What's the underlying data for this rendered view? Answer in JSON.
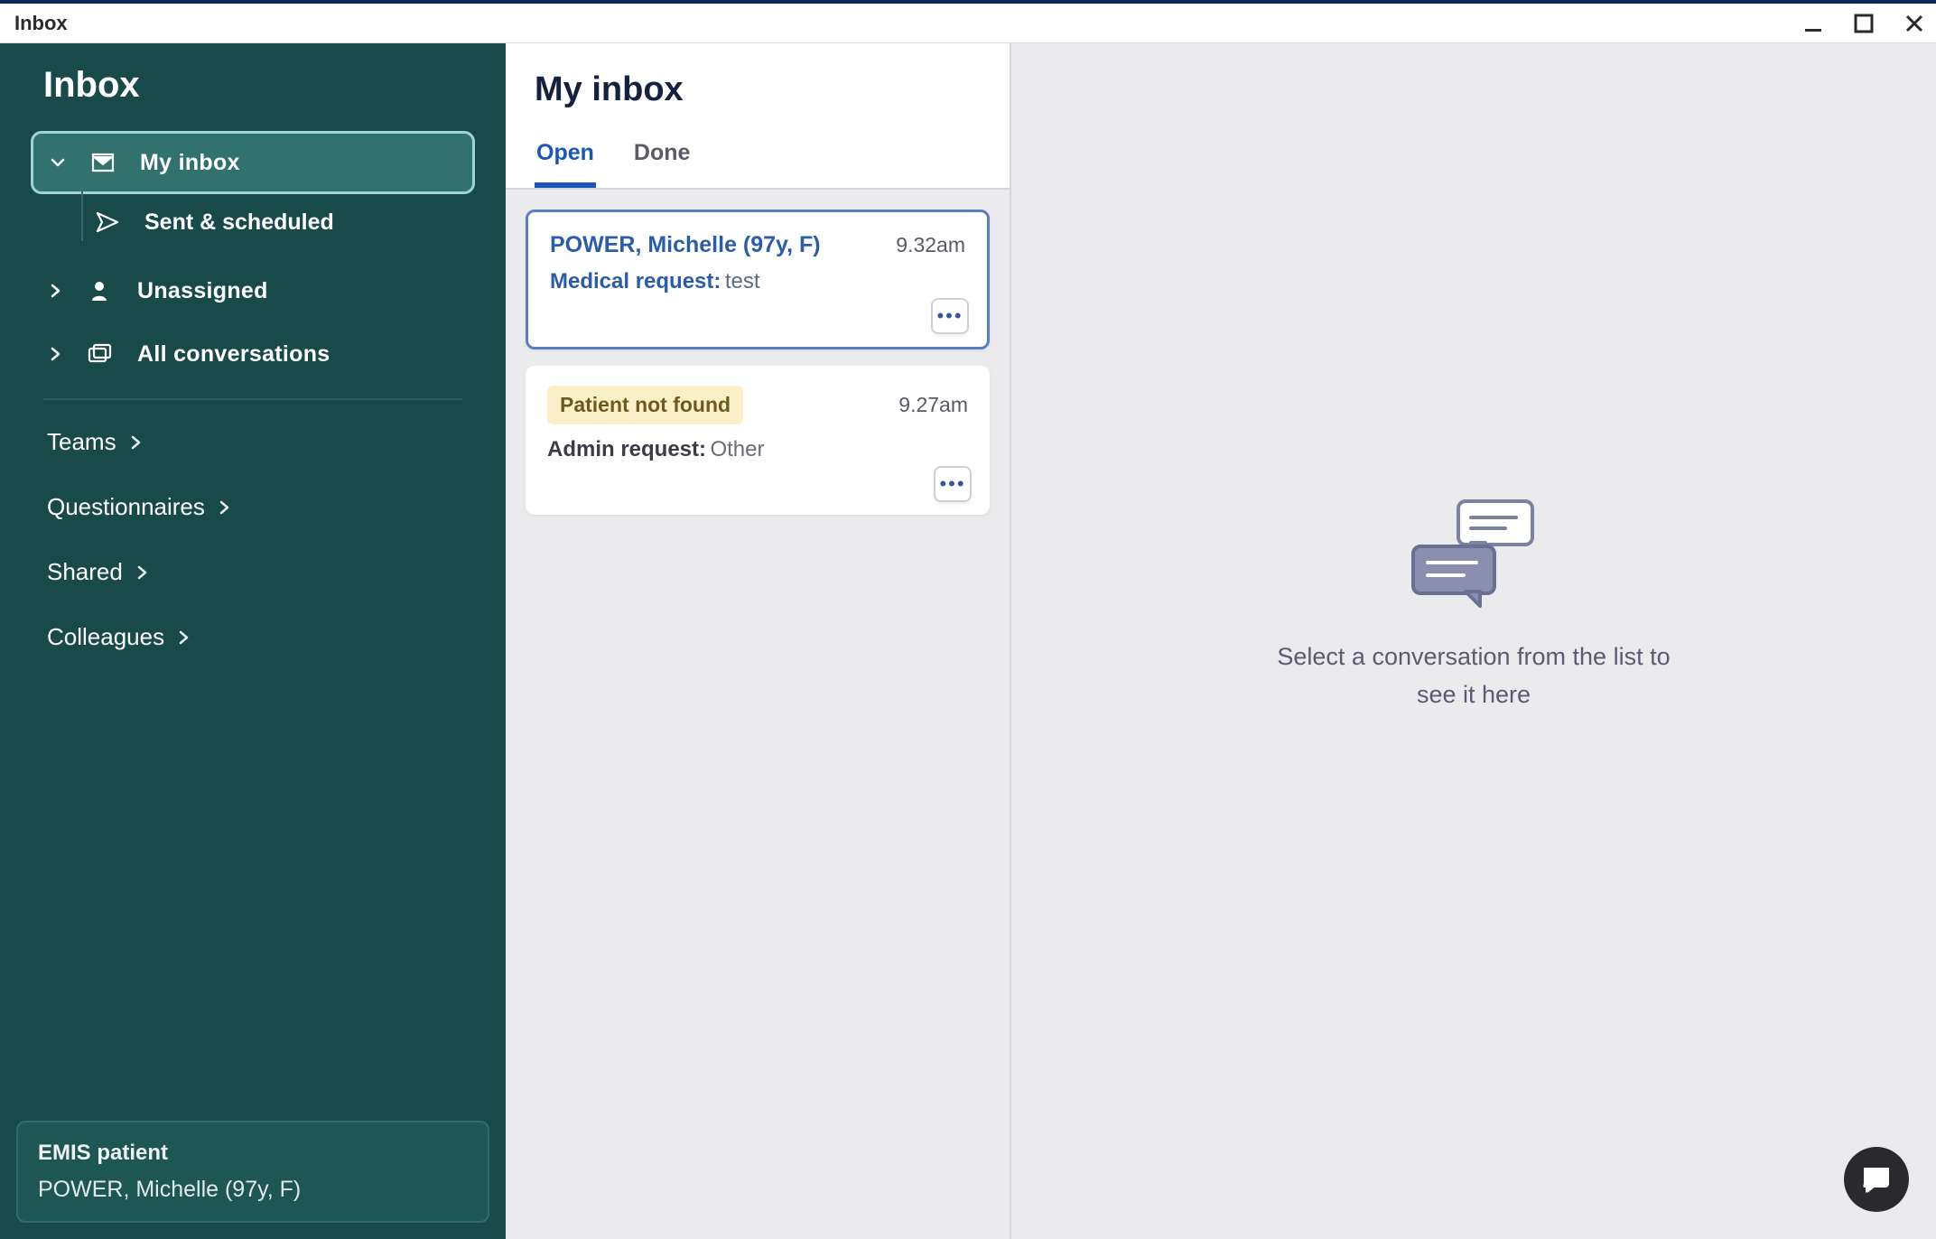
{
  "window": {
    "title": "Inbox"
  },
  "sidebar": {
    "title": "Inbox",
    "nav": {
      "my_inbox": "My inbox",
      "sent_scheduled": "Sent & scheduled",
      "unassigned": "Unassigned",
      "all_conversations": "All conversations"
    },
    "categories": {
      "teams": "Teams",
      "questionnaires": "Questionnaires",
      "shared": "Shared",
      "colleagues": "Colleagues"
    },
    "patient_card": {
      "heading": "EMIS patient",
      "name": "POWER, Michelle (97y, F)"
    }
  },
  "list": {
    "heading": "My inbox",
    "tabs": {
      "open": "Open",
      "done": "Done"
    },
    "items": [
      {
        "title": "POWER, Michelle (97y, F)",
        "time": "9.32am",
        "kind_label": "Medical request:",
        "kind_value": "test"
      },
      {
        "badge": "Patient not found",
        "time": "9.27am",
        "kind_label": "Admin request:",
        "kind_value": "Other"
      }
    ]
  },
  "detail": {
    "empty_message": "Select a conversation from the list to see it here"
  },
  "colors": {
    "sidebar_bg": "#184a4a",
    "sidebar_active": "#31726e",
    "primary_blue": "#1a55b8",
    "warn_chip": "#faf0c8"
  }
}
